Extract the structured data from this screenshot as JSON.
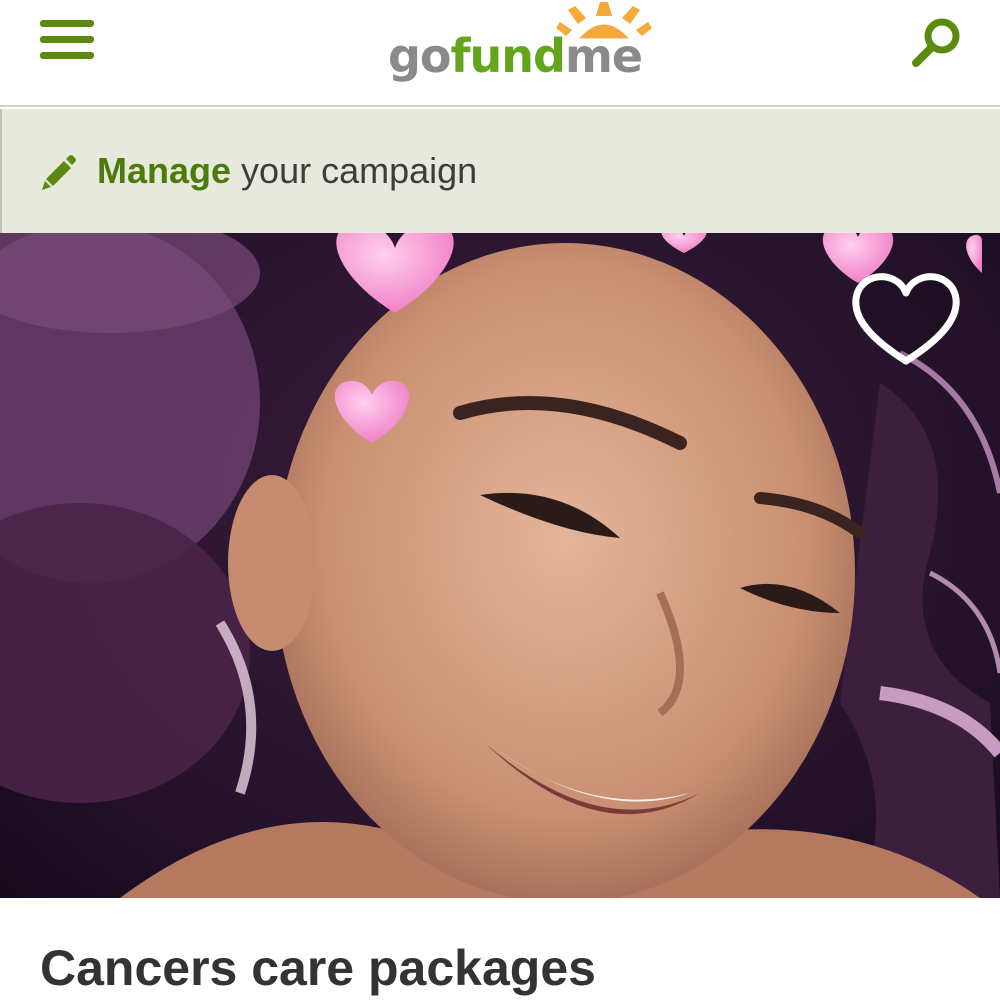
{
  "header": {
    "menu_icon": "hamburger-menu-icon",
    "logo": {
      "part_go": "go",
      "part_fund": "fund",
      "part_me": "me"
    },
    "search_icon": "search-icon"
  },
  "manage": {
    "icon": "pencil-icon",
    "strong": "Manage",
    "rest": " your campaign"
  },
  "campaign": {
    "photo_alt": "Campaign photo",
    "favorite_icon": "heart-outline-icon",
    "title": "Cancers care packages"
  },
  "colors": {
    "brand_green": "#5b8a0e",
    "manage_bg": "#e6e9dc",
    "logo_grey": "#8a8a8a",
    "logo_green": "#64a51e",
    "sun_orange": "#f5a93b"
  }
}
